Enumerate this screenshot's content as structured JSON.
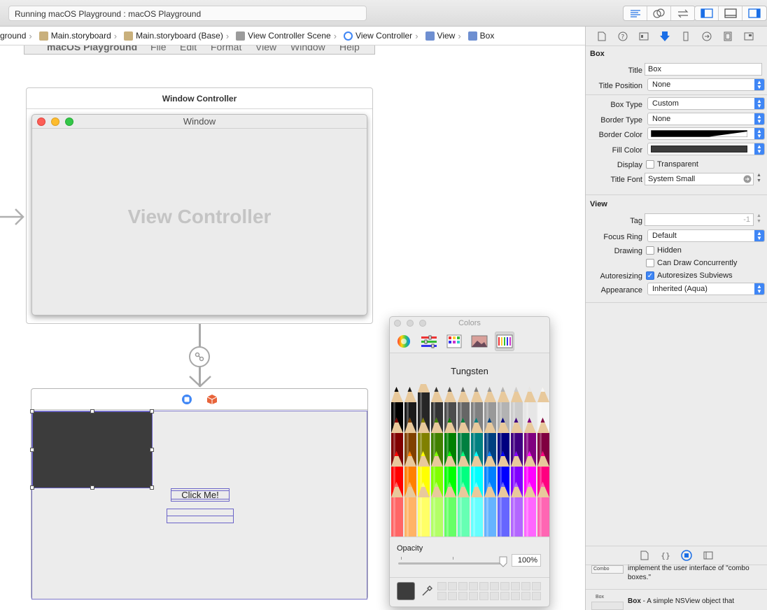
{
  "toolbar": {
    "activity": "Running macOS Playground : macOS Playground",
    "editor_icons": [
      "standard-editor-icon",
      "assistant-editor-icon",
      "version-editor-icon"
    ],
    "panel_icons": [
      "navigator-toggle-icon",
      "debug-area-toggle-icon",
      "utilities-toggle-icon"
    ]
  },
  "jumpbar": {
    "crumbs": [
      "ground",
      "Main.storyboard",
      "Main.storyboard (Base)",
      "View Controller Scene",
      "View Controller",
      "View",
      "Box"
    ]
  },
  "canvas": {
    "menubar": [
      "macOS Playground",
      "File",
      "Edit",
      "Format",
      "View",
      "Window",
      "Help"
    ],
    "window_controller_title": "Window Controller",
    "window_title": "Window",
    "view_controller_placeholder": "View Controller",
    "button_label": "Click Me!"
  },
  "colors_panel": {
    "title": "Colors",
    "pencil_name": "Tungsten",
    "opacity_label": "Opacity",
    "opacity_value": "100%",
    "opacity_fraction": 1.0,
    "current_color": "#3c3c3c",
    "modes": [
      "color-wheel-icon",
      "color-sliders-icon",
      "color-palettes-icon",
      "image-palettes-icon",
      "pencils-icon"
    ]
  },
  "inspector": {
    "box_section": {
      "header": "Box",
      "title_label": "Title",
      "title_value": "Box",
      "title_position_label": "Title Position",
      "title_position_value": "None",
      "box_type_label": "Box Type",
      "box_type_value": "Custom",
      "border_type_label": "Border Type",
      "border_type_value": "None",
      "border_color_label": "Border Color",
      "fill_color_label": "Fill Color",
      "display_label": "Display",
      "transparent_label": "Transparent",
      "title_font_label": "Title Font",
      "title_font_value": "System Small"
    },
    "view_section": {
      "header": "View",
      "tag_label": "Tag",
      "tag_value": "-1",
      "focus_ring_label": "Focus Ring",
      "focus_ring_value": "Default",
      "drawing_label": "Drawing",
      "hidden_label": "Hidden",
      "can_draw_label": "Can Draw Concurrently",
      "autoresizing_label": "Autoresizing",
      "autoresizes_label": "Autoresizes Subviews",
      "appearance_label": "Appearance",
      "appearance_value": "Inherited (Aqua)"
    },
    "library": {
      "combo_desc": "implement the user interface of \"combo boxes.\"",
      "combo_thumb": "Combo",
      "box_thumb": "Box",
      "box_name": "Box",
      "box_desc": " - A simple NSView object that"
    }
  },
  "colors": {
    "accent": "#3f86f5",
    "selection": "#6b64c8",
    "box_fill": "#3c3c3c"
  }
}
